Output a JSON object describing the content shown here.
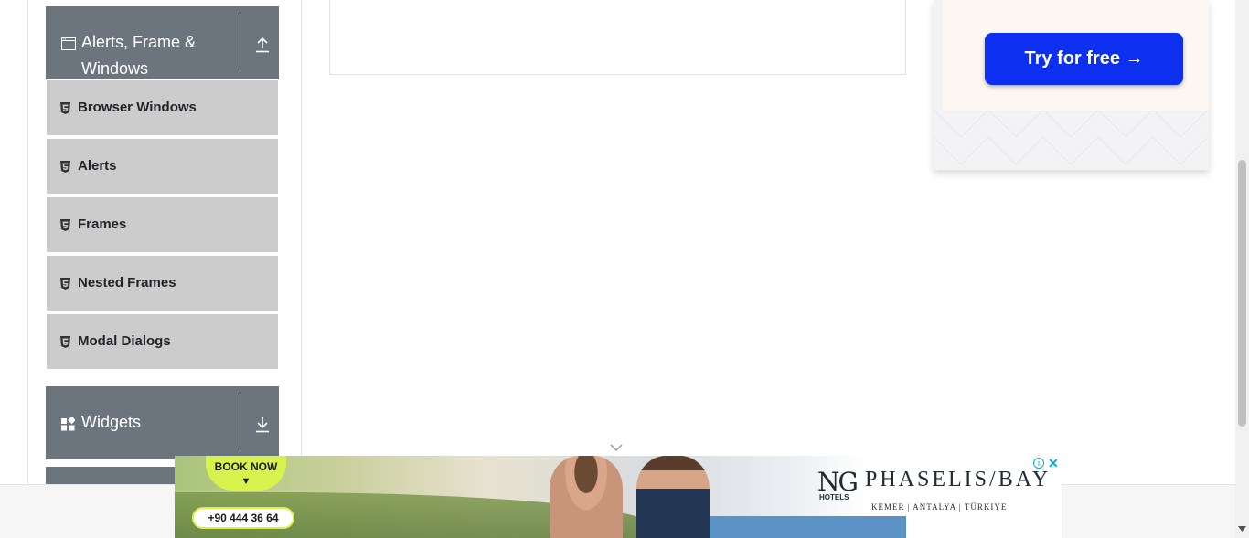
{
  "sidebar": {
    "groups": [
      {
        "title_line1": "Alerts, Frame &",
        "title_line2": "Windows",
        "icon": "window-icon",
        "toggle_icon": "collapse-up-icon",
        "expanded": true,
        "items": [
          {
            "label": "Browser Windows",
            "icon": "html5-icon"
          },
          {
            "label": "Alerts",
            "icon": "html5-icon"
          },
          {
            "label": "Frames",
            "icon": "html5-icon"
          },
          {
            "label": "Nested Frames",
            "icon": "html5-icon"
          },
          {
            "label": "Modal Dialogs",
            "icon": "html5-icon"
          }
        ]
      },
      {
        "title": "Widgets",
        "icon": "widgets-icon",
        "toggle_icon": "expand-down-icon",
        "expanded": false
      }
    ],
    "header_color": "#6c757d",
    "item_color": "#cccccc"
  },
  "right_ad": {
    "cta_label": "Try for free →",
    "cta_color": "#0c2ff0"
  },
  "banner_ad": {
    "book_label": "BOOK NOW",
    "book_arrow": "▼",
    "phone": "+90 444 36 64",
    "logo": "NG",
    "logo_sub": "HOTELS",
    "brand": "PHASELIS/BAY",
    "location": "KEMER | ANTALYA | TÜRKIYE",
    "info_glyph": "i",
    "close_glyph": "✕",
    "accent": "#d7f24d"
  }
}
